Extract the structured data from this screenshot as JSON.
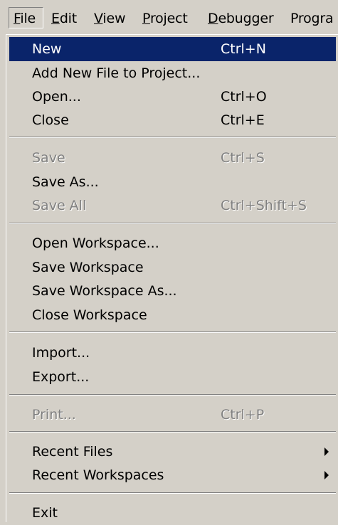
{
  "menubar": {
    "file": {
      "u": "F",
      "rest": "ile"
    },
    "edit": {
      "u": "E",
      "rest": "dit"
    },
    "view": {
      "u": "V",
      "rest": "iew"
    },
    "project": {
      "u": "P",
      "rest": "roject"
    },
    "debugger": {
      "u": "D",
      "rest": "ebugger"
    },
    "program": {
      "label": "Progra"
    }
  },
  "file_menu": {
    "new": {
      "label": "New",
      "shortcut": "Ctrl+N"
    },
    "add_new_file": {
      "label": "Add New File to Project..."
    },
    "open": {
      "label": "Open...",
      "shortcut": "Ctrl+O"
    },
    "close": {
      "label": "Close",
      "shortcut": "Ctrl+E"
    },
    "save": {
      "label": "Save",
      "shortcut": "Ctrl+S"
    },
    "save_as": {
      "label": "Save As..."
    },
    "save_all": {
      "label": "Save All",
      "shortcut": "Ctrl+Shift+S"
    },
    "open_workspace": {
      "label": "Open Workspace..."
    },
    "save_workspace": {
      "label": "Save Workspace"
    },
    "save_workspace_as": {
      "label": "Save Workspace As..."
    },
    "close_workspace": {
      "label": "Close Workspace"
    },
    "import": {
      "label": "Import..."
    },
    "export": {
      "label": "Export..."
    },
    "print": {
      "label": "Print...",
      "shortcut": "Ctrl+P"
    },
    "recent_files": {
      "label": "Recent Files"
    },
    "recent_workspaces": {
      "label": "Recent Workspaces"
    },
    "exit": {
      "label": "Exit"
    }
  },
  "colors": {
    "menu_bg": "#d4d0c8",
    "highlight": "#0a246a",
    "disabled_text": "#808080"
  }
}
